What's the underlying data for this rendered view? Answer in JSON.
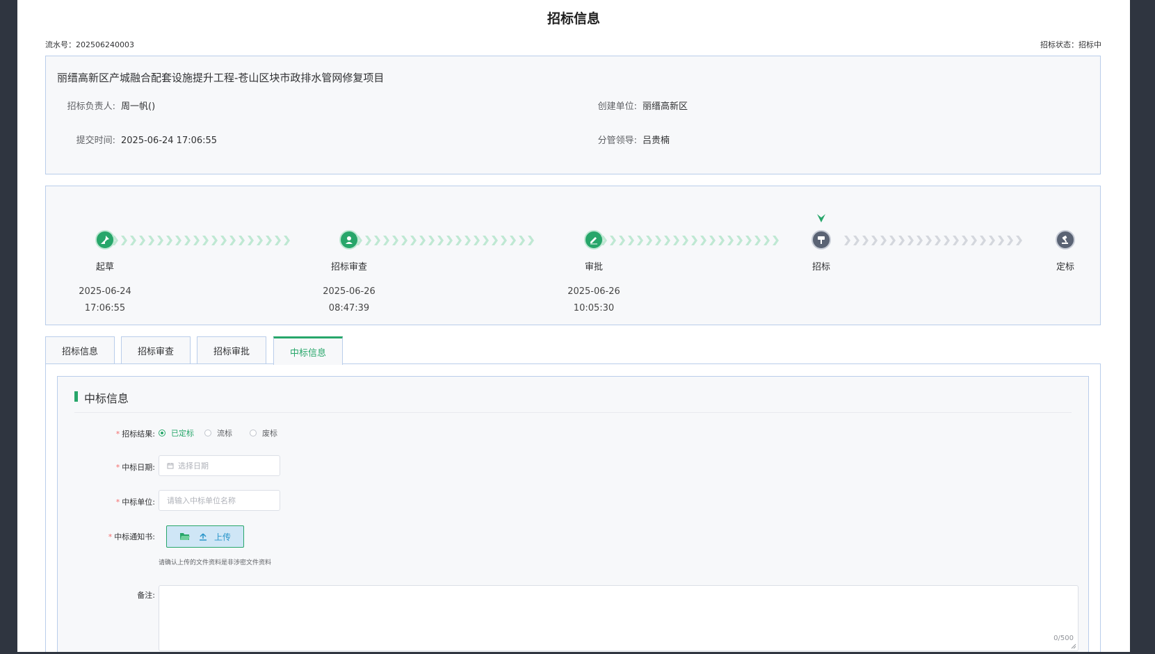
{
  "title": "招标信息",
  "serial": "流水号：202506240003",
  "status": "招标状态：招标中",
  "info": {
    "project_name": "丽缙高新区产城融合配套设施提升工程-苍山区块市政排水管网修复项目",
    "owner_label": "招标负责人:",
    "owner_value": "周一帆()",
    "submit_label": "提交时间:",
    "submit_value": "2025-06-24 17:06:55",
    "org_label": "创建单位:",
    "org_value": "丽缙高新区",
    "leader_label": "分管领导:",
    "leader_value": "吕贵楠"
  },
  "steps": [
    {
      "label": "起草",
      "date": "2025-06-24",
      "time": "17:06:55",
      "state": "done",
      "icon": "pin-icon"
    },
    {
      "label": "招标审查",
      "date": "2025-06-26",
      "time": "08:47:39",
      "state": "done",
      "icon": "user-icon"
    },
    {
      "label": "审批",
      "date": "2025-06-26",
      "time": "10:05:30",
      "state": "done",
      "icon": "edit-icon"
    },
    {
      "label": "招标",
      "date": "",
      "time": "",
      "state": "current",
      "icon": "hammer-icon"
    },
    {
      "label": "定标",
      "date": "",
      "time": "",
      "state": "todo",
      "icon": "gavel-icon"
    }
  ],
  "tabs": [
    "招标信息",
    "招标审查",
    "招标审批",
    "中标信息"
  ],
  "active_tab": 3,
  "form": {
    "section_title": "中标信息",
    "result_label": "招标结果:",
    "result_options": [
      "已定标",
      "流标",
      "废标"
    ],
    "result_selected": 0,
    "date_label": "中标日期:",
    "date_placeholder": "选择日期",
    "unit_label": "中标单位:",
    "unit_placeholder": "请输入中标单位名称",
    "notice_label": "中标通知书:",
    "upload_label": "上传",
    "upload_tip": "请确认上传的文件资料是非涉密文件资料",
    "remark_label": "备注:",
    "remark_count": "0/500"
  },
  "colors": {
    "accent": "#27a66a",
    "pending": "#5a6374",
    "border": "#b9cdea"
  }
}
